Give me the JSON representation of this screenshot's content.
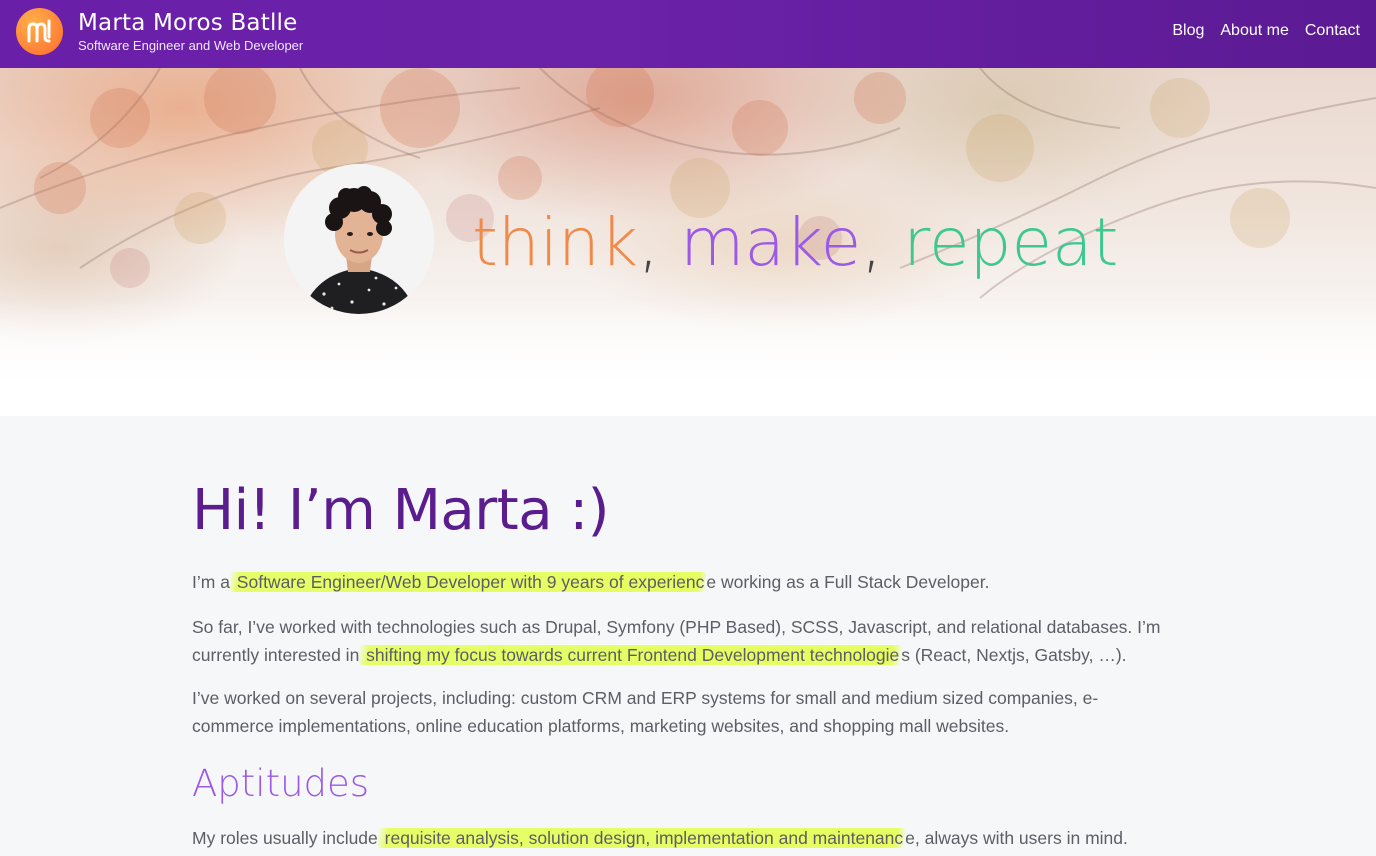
{
  "header": {
    "title": "Marta Moros Batlle",
    "subtitle": "Software Engineer and Web Developer",
    "nav": [
      {
        "label": "Blog"
      },
      {
        "label": "About me"
      },
      {
        "label": "Contact"
      }
    ]
  },
  "hero": {
    "slogan": {
      "word1": "think",
      "sep1": ", ",
      "word2": "make",
      "sep2": ", ",
      "word3": "repeat"
    }
  },
  "main": {
    "heading": "Hi! I’m Marta :)",
    "p1": {
      "pre": "I’m a",
      "highlight": " Software Engineer/Web Developer with 9 years of experienc",
      "post": "e working as a Full Stack Developer."
    },
    "p2": {
      "pre": "So far, I’ve worked with technologies such as Drupal, Symfony (PHP Based), SCSS, Javascript, and relational databases. I’m currently interested in",
      "highlight": " shifting my focus towards current Frontend Development technologie",
      "post": "s (React, Nextjs, Gatsby, …)."
    },
    "p3": "I’ve worked on several projects, including: custom CRM and ERP systems for small and medium sized companies, e-commerce implementations, online education platforms, marketing websites, and shopping mall websites.",
    "aptitudes_heading": "Aptitudes",
    "p4": {
      "pre": "My roles usually include",
      "highlight": " requisite analysis, solution design, implementation and maintenanc",
      "post": "e, always with users in mind."
    }
  },
  "colors": {
    "header_bg": "#6a1fa8",
    "heading": "#5b1d8e",
    "aptitudes": "#9b5ae6",
    "think": "#f08a4a",
    "make": "#9a5ae6",
    "repeat": "#3ec88f",
    "highlight": "#e4ff50"
  }
}
